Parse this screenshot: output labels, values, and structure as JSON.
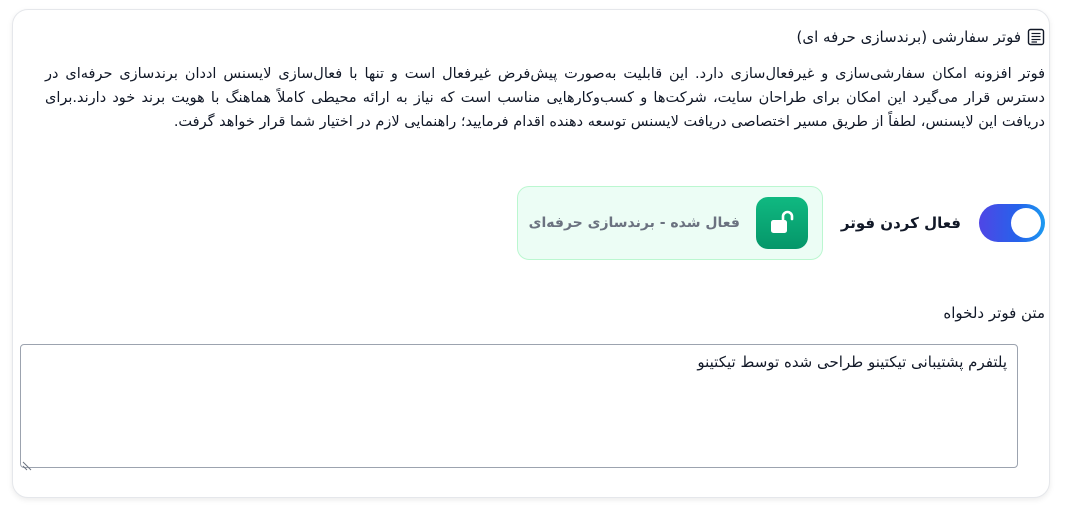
{
  "section": {
    "title": "فوتر سفارشی (برندسازی حرفه ای)",
    "description": "فوتر افزونه امکان سفارشی‌سازی و غیرفعال‌سازی دارد. این قابلیت به‌صورت پیش‌فرض غیرفعال است و تنها با فعال‌سازی لایسنس اددان برندسازی حرفه‌ای در دسترس قرار می‌گیرد این امکان برای طراحان سایت، شرکت‌ها و کسب‌وکارهایی مناسب است که نیاز به ارائه محیطی کاملاً هماهنگ با هویت برند خود دارند.برای دریافت این لایسنس، لطفاً از طریق مسیر اختصاصی دریافت لایسنس توسعه دهنده اقدام فرمایید؛ راهنمایی لازم در اختیار شما قرار خواهد گرفت."
  },
  "toggle": {
    "label": "فعال کردن فوتر",
    "state": "on"
  },
  "status": {
    "text": "فعال شده - برندسازی حرفه‌ای",
    "icon": "unlock-icon"
  },
  "footer_text": {
    "label": "متن فوتر دلخواه",
    "value": "پلتفرم پشتیبانی تیکتینو طراحی شده توسط تیکتینو"
  },
  "colors": {
    "toggle_gradient_start": "#4f46e5",
    "toggle_gradient_end": "#1d9bf0",
    "status_bg": "#ecfdf5",
    "status_badge": "#10b981"
  }
}
